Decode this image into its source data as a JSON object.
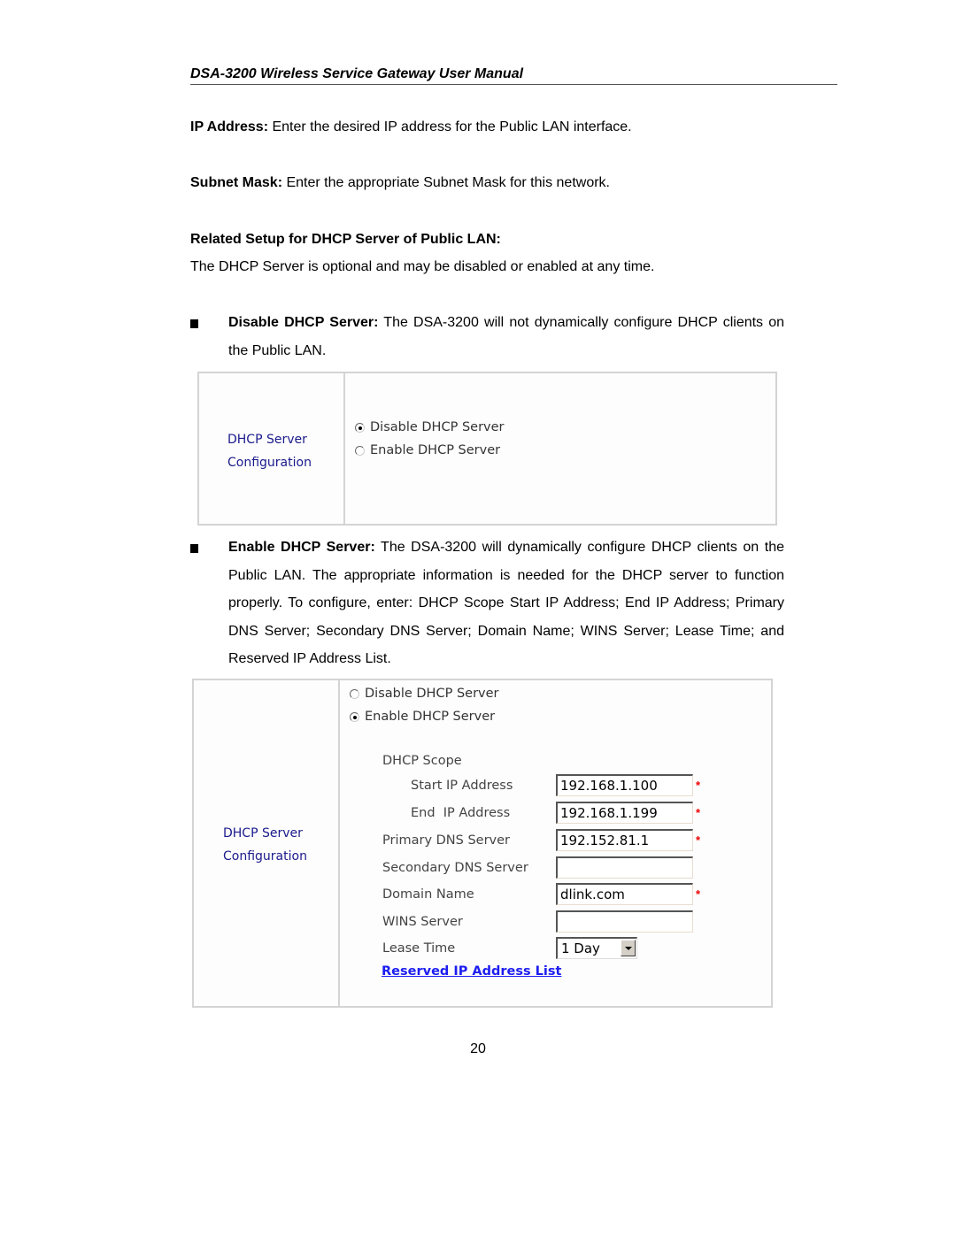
{
  "header": {
    "title": "DSA-3200 Wireless Service Gateway User Manual"
  },
  "paragraphs": {
    "ip_address": {
      "term": "IP Address:",
      "text": " Enter the desired IP address for the Public LAN interface."
    },
    "subnet_mask": {
      "term": "Subnet Mask:",
      "text": " Enter the appropriate Subnet Mask for this network."
    },
    "section_heading": "Related Setup for DHCP Server of Public LAN:",
    "dhcp_intro": "The DHCP Server is optional and may be disabled or enabled at any time."
  },
  "bullets": [
    {
      "term": "Disable DHCP Server:",
      "text": " The DSA-3200 will not dynamically configure DHCP clients on the Public LAN."
    },
    {
      "term": "Enable DHCP Server:",
      "text": " The DSA-3200 will dynamically configure DHCP clients on the Public LAN. The appropriate information is needed for the DHCP server to function properly. To configure, enter: DHCP Scope Start IP Address; End IP Address; Primary DNS Server; Secondary DNS Server; Domain Name; WINS Server; Lease Time; and Reserved IP Address List."
    }
  ],
  "panel1": {
    "label_line1": "DHCP Server",
    "label_line2": "Configuration",
    "options": [
      {
        "label": "Disable DHCP Server",
        "checked": true
      },
      {
        "label": "Enable DHCP Server",
        "checked": false
      }
    ]
  },
  "panel2": {
    "label_line1": "DHCP Server",
    "label_line2": "Configuration",
    "options": [
      {
        "label": "Disable DHCP Server",
        "checked": false
      },
      {
        "label": "Enable DHCP Server",
        "checked": true
      }
    ],
    "scope_heading": "DHCP Scope",
    "fields": {
      "start_ip": {
        "label": "Start IP Address",
        "value": "192.168.1.100",
        "required": "*"
      },
      "end_ip": {
        "label": "End  IP Address",
        "value": "192.168.1.199",
        "required": "*"
      },
      "primary_dns": {
        "label": "Primary DNS Server",
        "value": "192.152.81.1",
        "required": "*"
      },
      "secondary_dns": {
        "label": "Secondary DNS Server",
        "value": ""
      },
      "domain_name": {
        "label": "Domain Name",
        "value": "dlink.com",
        "required": "*"
      },
      "wins_server": {
        "label": "WINS Server",
        "value": ""
      },
      "lease_time": {
        "label": "Lease Time",
        "value": "1 Day"
      }
    },
    "reserved_link": "Reserved IP Address List"
  },
  "footer": {
    "page_number": "20"
  }
}
